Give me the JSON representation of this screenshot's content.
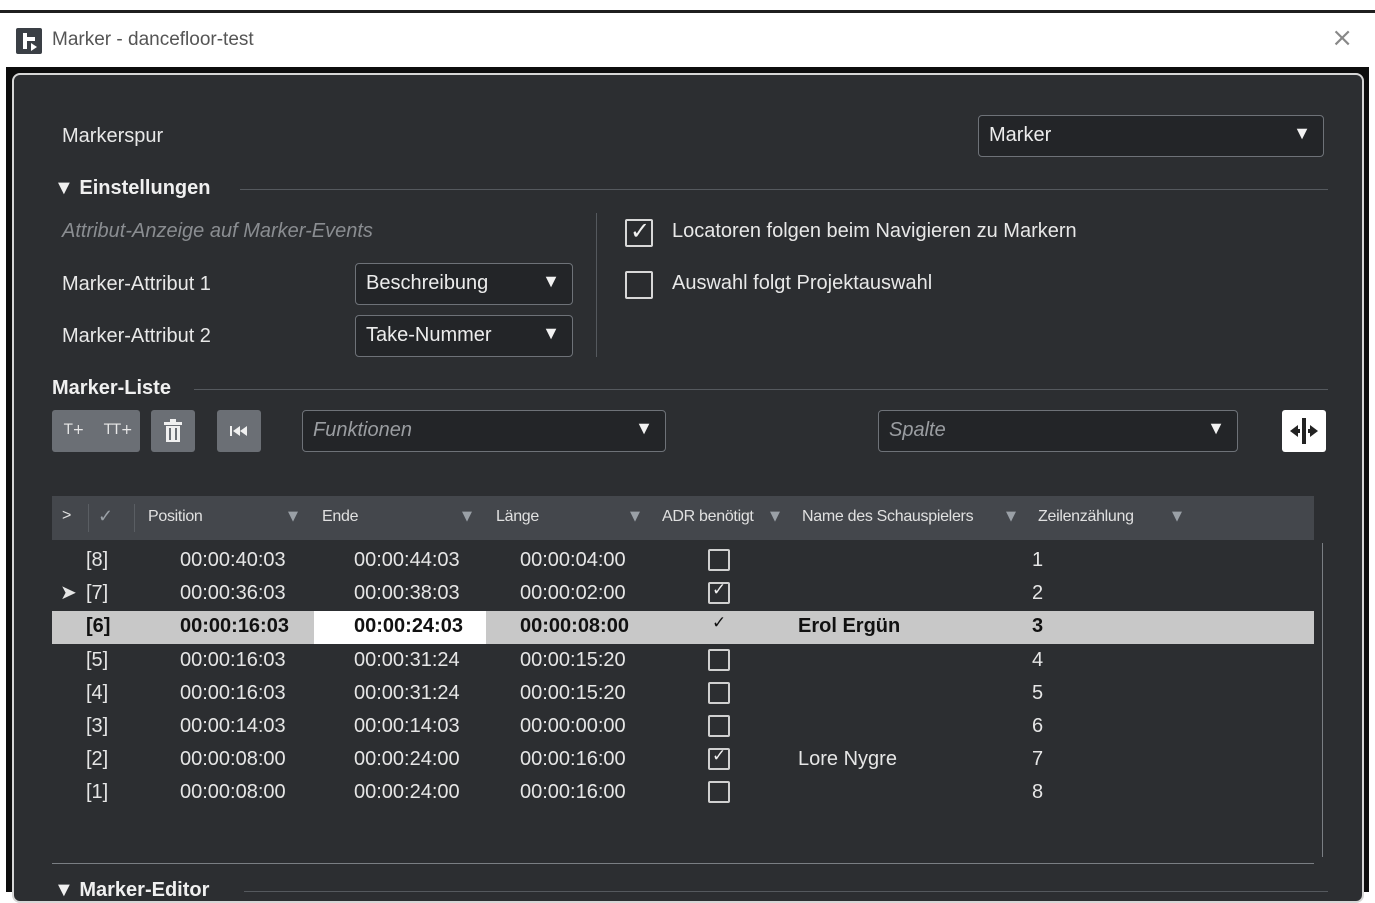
{
  "window": {
    "title": "Marker - dancefloor-test",
    "close_glyph": "×"
  },
  "markerspur": {
    "label": "Markerspur",
    "value": "Marker"
  },
  "einstellungen": {
    "title": "▼ Einstellungen",
    "attr_caption": "Attribut-Anzeige auf Marker-Events",
    "attr1_label": "Marker-Attribut 1",
    "attr1_value": "Beschreibung",
    "attr2_label": "Marker-Attribut 2",
    "attr2_value": "Take-Nummer",
    "locator_label": "Locatoren folgen beim Navigieren zu Markern",
    "locator_checked": true,
    "auswahl_label": "Auswahl folgt Projektauswahl",
    "auswahl_checked": false
  },
  "marker_liste": {
    "title": "Marker-Liste",
    "insert_label": "T+",
    "insert_multi_label": "TT+",
    "funktionen_placeholder": "Funktionen",
    "spalte_placeholder": "Spalte",
    "icons": [
      "insert-marker-icon",
      "insert-multiple-markers-icon",
      "trash-icon",
      "go-to-start-icon",
      "column-layout-icon"
    ]
  },
  "table": {
    "expand_glyph": ">",
    "check_glyph": "✓",
    "headers": {
      "position": "Position",
      "ende": "Ende",
      "laenge": "Länge",
      "adr": "ADR benötigt",
      "name": "Name des Schauspielers",
      "zeilen": "Zeilenzählung"
    },
    "current_marker_glyph": "➤",
    "rows": [
      {
        "id": "[8]",
        "position": "00:00:40:03",
        "ende": "00:00:44:03",
        "laenge": "00:00:04:00",
        "adr": false,
        "name": "",
        "zeile": "1"
      },
      {
        "id": "[7]",
        "position": "00:00:36:03",
        "ende": "00:00:38:03",
        "laenge": "00:00:02:00",
        "adr": true,
        "name": "",
        "zeile": "2"
      },
      {
        "id": "[6]",
        "position": "00:00:16:03",
        "ende": "00:00:24:03",
        "laenge": "00:00:08:00",
        "adr": true,
        "name": "Erol Ergün",
        "zeile": "3"
      },
      {
        "id": "[5]",
        "position": "00:00:16:03",
        "ende": "00:00:31:24",
        "laenge": "00:00:15:20",
        "adr": false,
        "name": "",
        "zeile": "4"
      },
      {
        "id": "[4]",
        "position": "00:00:16:03",
        "ende": "00:00:31:24",
        "laenge": "00:00:15:20",
        "adr": false,
        "name": "",
        "zeile": "5"
      },
      {
        "id": "[3]",
        "position": "00:00:14:03",
        "ende": "00:00:14:03",
        "laenge": "00:00:00:00",
        "adr": false,
        "name": "",
        "zeile": "6"
      },
      {
        "id": "[2]",
        "position": "00:00:08:00",
        "ende": "00:00:24:00",
        "laenge": "00:00:16:00",
        "adr": true,
        "name": "Lore Nygre",
        "zeile": "7"
      },
      {
        "id": "[1]",
        "position": "00:00:08:00",
        "ende": "00:00:24:00",
        "laenge": "00:00:16:00",
        "adr": false,
        "name": "",
        "zeile": "8"
      }
    ],
    "selected_row": "[6]",
    "current_row": "[7]"
  },
  "marker_editor": {
    "title": "▼ Marker-Editor"
  },
  "colors": {
    "panel_bg": "#2c2e31",
    "header_bg": "#44474c",
    "selected_row_bg": "#c8c8c8"
  }
}
